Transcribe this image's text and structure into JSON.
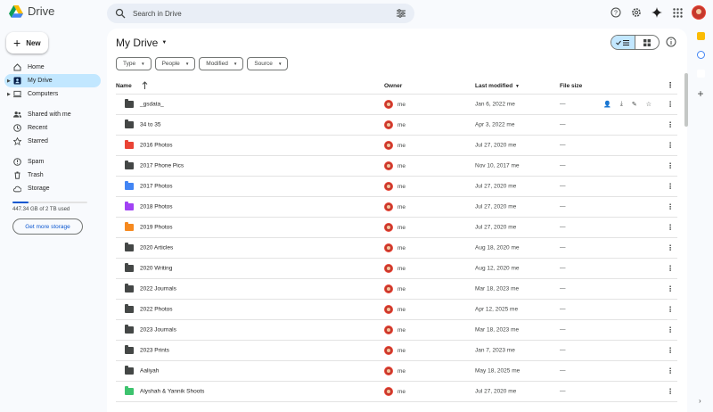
{
  "app": {
    "name": "Drive"
  },
  "search": {
    "placeholder": "Search in Drive"
  },
  "sidebar": {
    "new_label": "New",
    "items": [
      {
        "label": "Home",
        "icon": "home-icon"
      },
      {
        "label": "My Drive",
        "icon": "my-drive-icon",
        "active": true
      },
      {
        "label": "Computers",
        "icon": "computer-icon"
      },
      {
        "label": "Shared with me",
        "icon": "shared-icon"
      },
      {
        "label": "Recent",
        "icon": "clock-icon"
      },
      {
        "label": "Starred",
        "icon": "star-icon"
      },
      {
        "label": "Spam",
        "icon": "spam-icon"
      },
      {
        "label": "Trash",
        "icon": "trash-icon"
      },
      {
        "label": "Storage",
        "icon": "cloud-icon"
      }
    ],
    "storage_used": "447.34 GB of 2 TB used",
    "storage_fraction": 0.22,
    "storage_button": "Get more storage"
  },
  "main": {
    "title": "My Drive",
    "filters": [
      "Type",
      "People",
      "Modified",
      "Source"
    ],
    "columns": {
      "name": "Name",
      "owner": "Owner",
      "modified": "Last modified",
      "size": "File size"
    },
    "rows": [
      {
        "name": "_gsdata_",
        "owner": "me",
        "modified": "Jan 6, 2022 me",
        "size": "—",
        "color": "#444746"
      },
      {
        "name": "34 to 35",
        "owner": "me",
        "modified": "Apr 3, 2022 me",
        "size": "—",
        "color": "#444746"
      },
      {
        "name": "2016 Photos",
        "owner": "me",
        "modified": "Jul 27, 2020 me",
        "size": "—",
        "color": "#ea4335"
      },
      {
        "name": "2017 Phone Pics",
        "owner": "me",
        "modified": "Nov 10, 2017 me",
        "size": "—",
        "color": "#444746"
      },
      {
        "name": "2017 Photos",
        "owner": "me",
        "modified": "Jul 27, 2020 me",
        "size": "—",
        "color": "#4285f4"
      },
      {
        "name": "2018 Photos",
        "owner": "me",
        "modified": "Jul 27, 2020 me",
        "size": "—",
        "color": "#a142f4"
      },
      {
        "name": "2019 Photos",
        "owner": "me",
        "modified": "Jul 27, 2020 me",
        "size": "—",
        "color": "#f6891f"
      },
      {
        "name": "2020 Articles",
        "owner": "me",
        "modified": "Aug 18, 2020 me",
        "size": "—",
        "color": "#444746"
      },
      {
        "name": "2020 Writing",
        "owner": "me",
        "modified": "Aug 12, 2020 me",
        "size": "—",
        "color": "#444746"
      },
      {
        "name": "2022 Journals",
        "owner": "me",
        "modified": "Mar 18, 2023 me",
        "size": "—",
        "color": "#444746"
      },
      {
        "name": "2022 Photos",
        "owner": "me",
        "modified": "Apr 12, 2025 me",
        "size": "—",
        "color": "#444746"
      },
      {
        "name": "2023 Journals",
        "owner": "me",
        "modified": "Mar 18, 2023 me",
        "size": "—",
        "color": "#444746"
      },
      {
        "name": "2023 Prints",
        "owner": "me",
        "modified": "Jan 7, 2023 me",
        "size": "—",
        "color": "#444746"
      },
      {
        "name": "Aaliyah",
        "owner": "me",
        "modified": "May 18, 2025 me",
        "size": "—",
        "color": "#444746"
      },
      {
        "name": "Alyshah & Yannik Shoots",
        "owner": "me",
        "modified": "Jul 27, 2020 me",
        "size": "—",
        "color": "#3dc36e"
      }
    ]
  },
  "colors": {
    "accent": "#0b57d0",
    "selected_nav": "#c2e7ff",
    "background": "#f8fafd"
  }
}
